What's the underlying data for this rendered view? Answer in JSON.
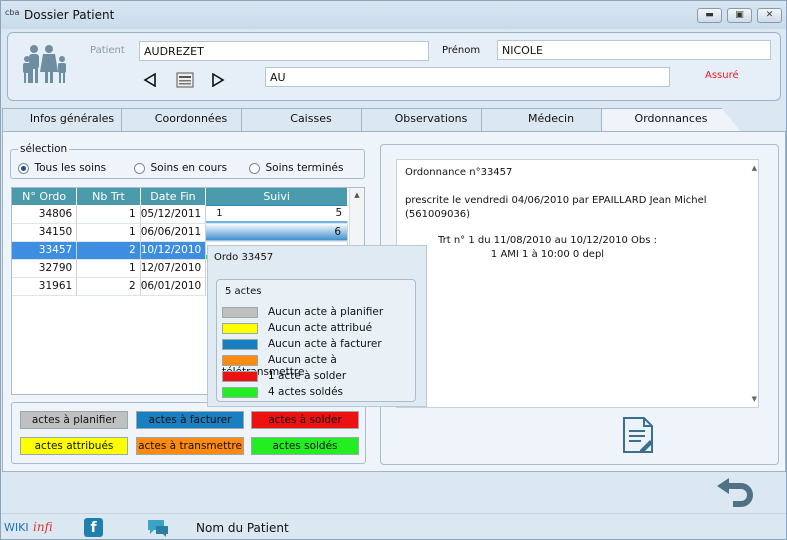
{
  "window": {
    "app_icon": "cba",
    "title": "Dossier Patient",
    "buttons": [
      "minimize-icon",
      "maximize-icon",
      "close-icon"
    ]
  },
  "header": {
    "patient_label": "Patient",
    "patient_value": "AUDREZET",
    "prenom_label": "Prénom",
    "prenom_value": "NICOLE",
    "address_value": "AU",
    "status": "Assuré",
    "status_color": "#e02020",
    "nav_icons": [
      "prev-arrow-icon",
      "card-icon",
      "next-arrow-icon"
    ]
  },
  "tabs": [
    "Infos générales",
    "Coordonnées",
    "Caisses",
    "Observations",
    "Médecin",
    "Ordonnances"
  ],
  "active_tab": "Ordonnances",
  "selection": {
    "label": "sélection",
    "options": [
      "Tous les soins",
      "Soins en cours",
      "Soins terminés"
    ],
    "selected": "Tous les soins"
  },
  "table": {
    "headers": [
      "N° Ordo",
      "Nb Trt",
      "Date Fin",
      "Suivi"
    ],
    "rows": [
      {
        "ordo": "34806",
        "nb": "1",
        "date": "05/12/2011",
        "suivi": "5",
        "suivi_left": "1"
      },
      {
        "ordo": "34150",
        "nb": "1",
        "date": "06/06/2011",
        "suivi": "6",
        "suivi_left": ""
      },
      {
        "ordo": "33457",
        "nb": "2",
        "date": "10/12/2010",
        "suivi": "",
        "suivi_left": ""
      },
      {
        "ordo": "32790",
        "nb": "1",
        "date": "12/07/2010",
        "suivi": "",
        "suivi_left": ""
      },
      {
        "ordo": "31961",
        "nb": "2",
        "date": "06/01/2010",
        "suivi": "",
        "suivi_left": ""
      }
    ],
    "selected_row": 2
  },
  "legend_buttons": [
    {
      "label": "actes à planifier",
      "color": "#c0c0c0"
    },
    {
      "label": "actes à facturer",
      "color": "#1a7fc0"
    },
    {
      "label": "actes à solder",
      "color": "#ee1111"
    },
    {
      "label": "actes attribués",
      "color": "#ffff00"
    },
    {
      "label": "actes à transmettre",
      "color": "#ff8a10"
    },
    {
      "label": "actes soldés",
      "color": "#22ee22"
    }
  ],
  "tooltip": {
    "title": "Ordo 33457",
    "count": "5 actes",
    "items": [
      {
        "label": "Aucun acte à planifier",
        "color": "#c0c0c0"
      },
      {
        "label": "Aucun acte attribué",
        "color": "#ffff00"
      },
      {
        "label": "Aucun acte à facturer",
        "color": "#1a7fc0"
      },
      {
        "label": "Aucun acte à télétransmettre",
        "color": "#ff8a10"
      },
      {
        "label": "1 acte à solder",
        "color": "#ee1111"
      },
      {
        "label": "4 actes soldés",
        "color": "#22ee22"
      }
    ]
  },
  "ordonnance": {
    "title": "Ordonnance n°33457",
    "line1": "prescrite le vendredi 04/06/2010 par EPAILLARD Jean Michel",
    "line2": "(561009036)",
    "line3": "Trt n° 1 du 11/08/2010 au 10/12/2010 Obs :",
    "line4": "1 AMI 1 à 10:00 0 depl"
  },
  "footer": {
    "wiki": "WIKI",
    "infi": "infi",
    "patient_name_label": "Nom du Patient"
  }
}
